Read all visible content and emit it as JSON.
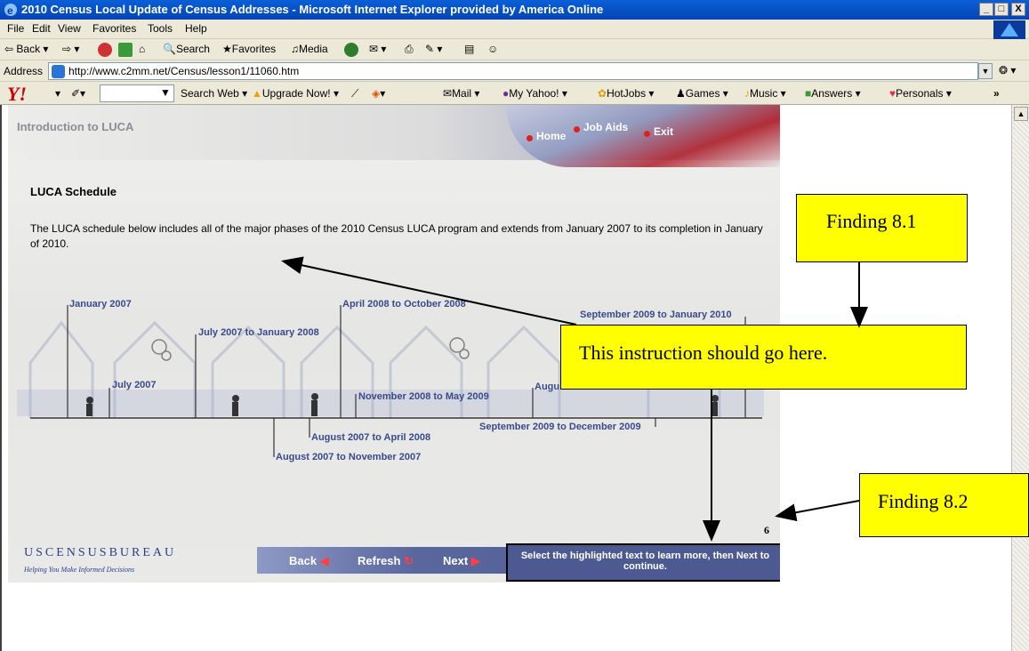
{
  "window": {
    "title": "2010 Census Local Update of Census Addresses - Microsoft Internet Explorer provided by America Online",
    "buttons": [
      "_",
      "□",
      "X"
    ]
  },
  "menu": [
    "File",
    "Edit",
    "View",
    "Favorites",
    "Tools",
    "Help"
  ],
  "toolbar": {
    "back": "Back",
    "search": "Search",
    "favorites": "Favorites",
    "media": "Media"
  },
  "address": {
    "label": "Address",
    "url": "http://www.c2mm.net/Census/lesson1/11060.htm"
  },
  "yahoo": {
    "logo": "Y!",
    "search_web": "Search Web",
    "upgrade": "Upgrade Now!",
    "mail": "Mail",
    "my_yahoo": "My Yahoo!",
    "hotjobs": "HotJobs",
    "games": "Games",
    "music": "Music",
    "answers": "Answers",
    "personals": "Personals",
    "more": "»"
  },
  "lesson": {
    "section": "Introduction to LUCA",
    "nav": {
      "home": "Home",
      "job_aids": "Job Aids",
      "exit": "Exit"
    },
    "heading": "LUCA Schedule",
    "description": "The LUCA schedule below includes all of the major phases of the 2010 Census LUCA program and extends from January 2007 to its completion in January of 2010.",
    "timeline": {
      "jan2007": "January  2007",
      "jul2007": "July 2007",
      "jul2007_jan2008": "July 2007 to January 2008",
      "aug2007_nov2007": "August 2007 to November 2007",
      "aug2007_apr2008": "August 2007 to April 2008",
      "apr2008_oct2008": "April 2008 to October 2008",
      "nov2008_may2009": "November 2008 to May 2009",
      "aug_partial": "Augu",
      "sep2009_dec2009": "September 2009 to December 2009",
      "sep2009_jan2010": "September 2009 to January 2010"
    },
    "bureau": {
      "logo": "USCENSUSBUREAU",
      "tagline": "Helping You Make Informed Decisions"
    },
    "navbar": {
      "back": "Back",
      "refresh": "Refresh",
      "next": "Next"
    },
    "page_number": "6",
    "instruction": "Select the highlighted text to learn more, then Next to continue."
  },
  "annotations": {
    "finding_1": "Finding 8.1",
    "finding_2": "Finding 8.2",
    "note": "This instruction should go here."
  },
  "colors": {
    "callout": "#ffff00",
    "title_bar": "#0a5fd6",
    "timeline_text": "#394a8c",
    "nav_bar": "#4d5a92"
  }
}
